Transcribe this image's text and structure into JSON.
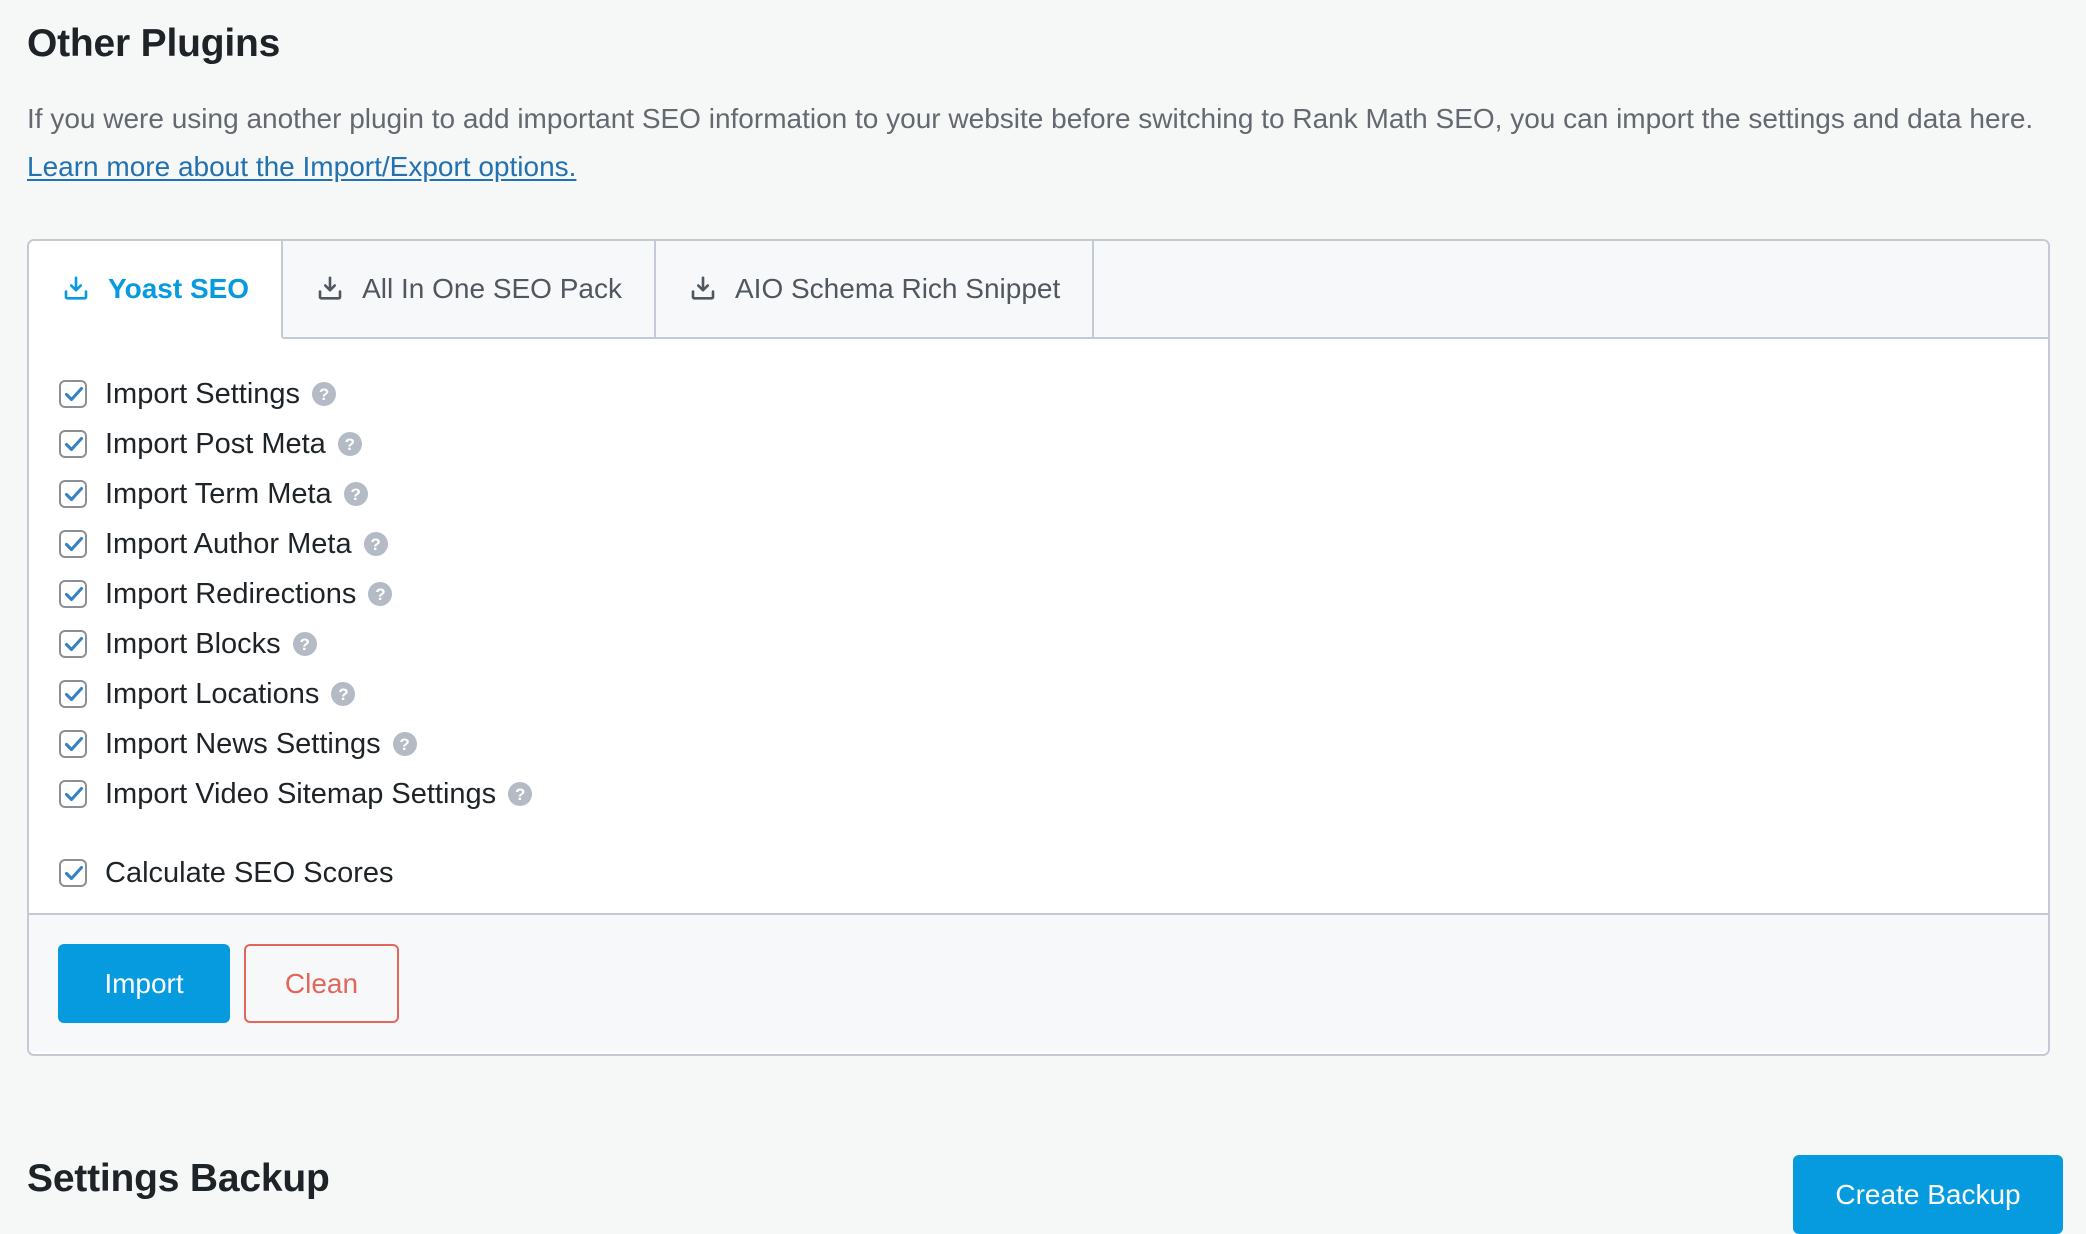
{
  "section": {
    "title": "Other Plugins",
    "description_before_link": "If you were using another plugin to add important SEO information to your website before switching to Rank Math SEO, you can import the settings and data here. ",
    "link_text": "Learn more about the Import/Export options."
  },
  "tabs": [
    {
      "label": "Yoast SEO",
      "icon": "import-download-icon",
      "active": true
    },
    {
      "label": "All In One SEO Pack",
      "icon": "import-download-icon",
      "active": false
    },
    {
      "label": "AIO Schema Rich Snippet",
      "icon": "import-download-icon",
      "active": false
    }
  ],
  "checkboxes": [
    {
      "label": "Import Settings",
      "checked": true,
      "help": "?"
    },
    {
      "label": "Import Post Meta",
      "checked": true,
      "help": "?"
    },
    {
      "label": "Import Term Meta",
      "checked": true,
      "help": "?"
    },
    {
      "label": "Import Author Meta",
      "checked": true,
      "help": "?"
    },
    {
      "label": "Import Redirections",
      "checked": true,
      "help": "?"
    },
    {
      "label": "Import Blocks",
      "checked": true,
      "help": "?"
    },
    {
      "label": "Import Locations",
      "checked": true,
      "help": "?"
    },
    {
      "label": "Import News Settings",
      "checked": true,
      "help": "?"
    },
    {
      "label": "Import Video Sitemap Settings",
      "checked": true,
      "help": "?"
    },
    {
      "label": "Calculate SEO Scores",
      "checked": true,
      "help": null,
      "spaced": true
    }
  ],
  "footer": {
    "import_label": "Import",
    "clean_label": "Clean"
  },
  "backup_section": {
    "title": "Settings Backup",
    "create_backup_label": "Create Backup"
  },
  "colors": {
    "accent_blue": "#069ade",
    "link_blue": "#2271b1",
    "danger_red": "#e2665a",
    "checkbox_check": "#3582c4",
    "help_gray": "#b4bbc4",
    "body_text": "#646970",
    "heading_text": "#1d2327",
    "panel_border": "#c3cad3",
    "page_bg": "#f6f7f7"
  }
}
